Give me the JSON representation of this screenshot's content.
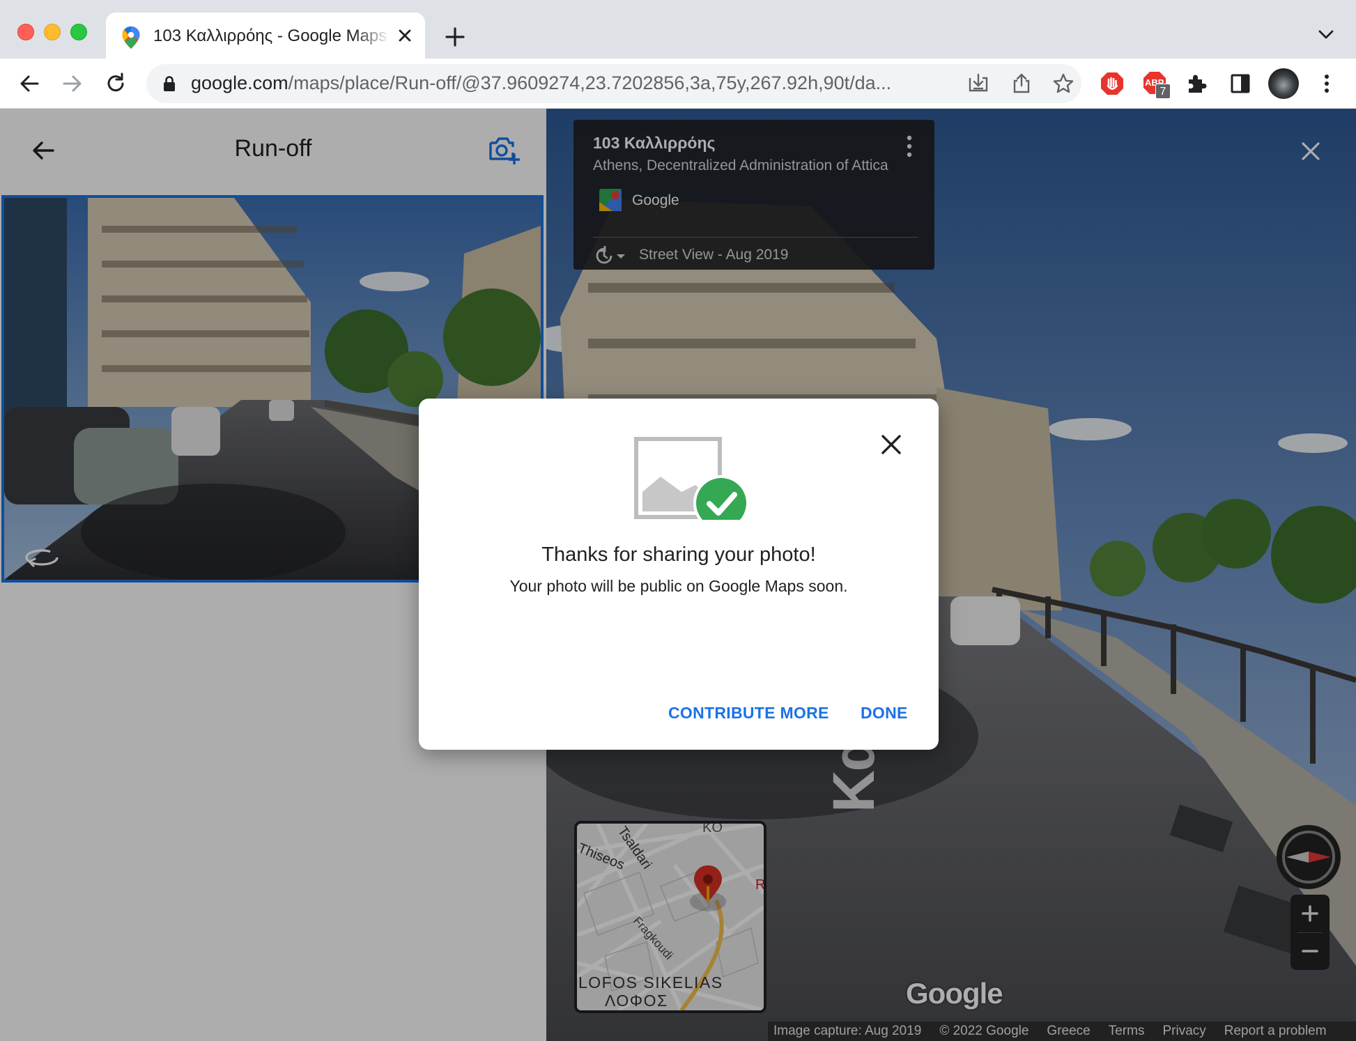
{
  "browser": {
    "tab_title": "103 Καλλιρρόης - Google Maps",
    "url_host": "google.com",
    "url_path": "/maps/place/Run-off/@37.9609274,23.7202856,3a,75y,267.92h,90t/da...",
    "extension_badge": "7",
    "extension_abp_label": "ABP"
  },
  "side_panel": {
    "title": "Run-off"
  },
  "info_card": {
    "title": "103 Καλλιρρόης",
    "subtitle": "Athens, Decentralized Administration of Attica",
    "provider": "Google",
    "street_view_date": "Street View - Aug 2019"
  },
  "minimap": {
    "labels": {
      "thiseos": "Thiseos",
      "tsaldari": "Tsaldari",
      "fragkoudi": "Fragkoudi",
      "lofos_latin": "LOFOS SIKELIAS",
      "lofos_greek": "ΛΟΦΟΣ",
      "ko": "KO",
      "r": "R"
    }
  },
  "street_view": {
    "street_label": "Καλλιρρόης",
    "logo": "Google"
  },
  "footer": {
    "items": [
      "Image capture: Aug 2019",
      "© 2022 Google",
      "Greece",
      "Terms",
      "Privacy",
      "Report a problem"
    ]
  },
  "dialog": {
    "title": "Thanks for sharing your photo!",
    "message": "Your photo will be public on Google Maps soon.",
    "contribute_more": "CONTRIBUTE MORE",
    "done": "DONE"
  },
  "colors": {
    "accent": "#1a73e8",
    "success": "#34a853",
    "tab_bg": "#ffffff",
    "chrome_bg": "#dee1e6"
  },
  "icons": {
    "back": "arrow-left-icon",
    "forward": "arrow-right-icon",
    "reload": "reload-icon",
    "lock": "lock-icon",
    "install": "install-icon",
    "share": "share-icon",
    "bookmark": "star-icon",
    "add_photo": "camera-plus-icon",
    "rotate": "rotate-360-icon",
    "close": "close-icon",
    "history": "history-icon",
    "more": "more-vert-icon",
    "check": "check-circle-icon",
    "compass": "compass-icon"
  }
}
